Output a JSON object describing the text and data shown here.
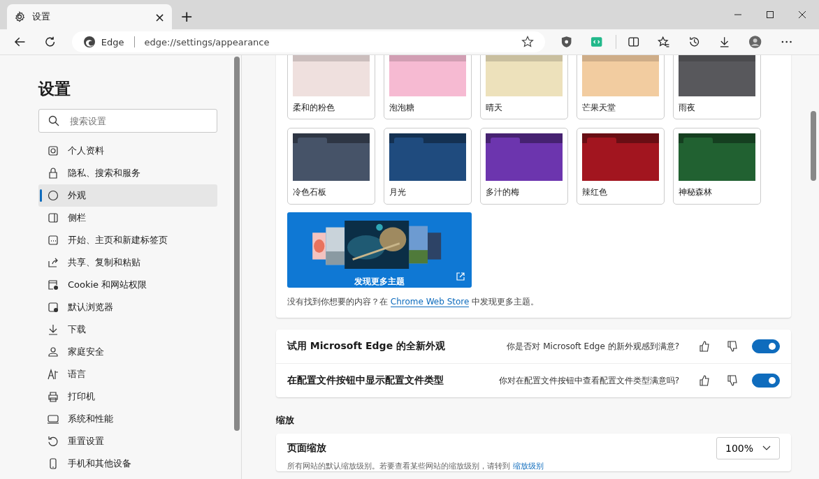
{
  "tab": {
    "title": "设置",
    "close": "×",
    "new_tab": "+"
  },
  "address": {
    "site": "Edge",
    "url": "edge://settings/appearance"
  },
  "sidebar": {
    "title": "设置",
    "search": {
      "placeholder": "搜索设置"
    },
    "items": [
      {
        "label": "个人资料",
        "selected": false
      },
      {
        "label": "隐私、搜索和服务",
        "selected": false
      },
      {
        "label": "外观",
        "selected": true
      },
      {
        "label": "侧栏",
        "selected": false
      },
      {
        "label": "开始、主页和新建标签页",
        "selected": false
      },
      {
        "label": "共享、复制和粘贴",
        "selected": false
      },
      {
        "label": "Cookie 和网站权限",
        "selected": false
      },
      {
        "label": "默认浏览器",
        "selected": false
      },
      {
        "label": "下载",
        "selected": false
      },
      {
        "label": "家庭安全",
        "selected": false
      },
      {
        "label": "语言",
        "selected": false
      },
      {
        "label": "打印机",
        "selected": false
      },
      {
        "label": "系统和性能",
        "selected": false
      },
      {
        "label": "重置设置",
        "selected": false
      },
      {
        "label": "手机和其他设备",
        "selected": false
      }
    ]
  },
  "themes": [
    {
      "name": "柔和的粉色",
      "color": "#efe0de"
    },
    {
      "name": "泡泡糖",
      "color": "#f6bad2"
    },
    {
      "name": "晴天",
      "color": "#ede1bb"
    },
    {
      "name": "芒果天堂",
      "color": "#f2cca0"
    },
    {
      "name": "雨夜",
      "color": "#58585c"
    },
    {
      "name": "冷色石板",
      "color": "#465368"
    },
    {
      "name": "月光",
      "color": "#1f4b7e"
    },
    {
      "name": "多汁的梅",
      "color": "#6c35ae"
    },
    {
      "name": "辣红色",
      "color": "#a2151f"
    },
    {
      "name": "神秘森林",
      "color": "#216131"
    }
  ],
  "discover": {
    "label": "发现更多主题"
  },
  "note": {
    "before": "没有找到你想要的内容？在",
    "link": "Chrome Web Store",
    "after": "中发现更多主题。"
  },
  "feedback_rows": [
    {
      "title": "试用 Microsoft Edge 的全新外观",
      "question": "你是否对 Microsoft Edge 的新外观感到满意?",
      "on": true
    },
    {
      "title": "在配置文件按钮中显示配置文件类型",
      "question": "你对在配置文件按钮中查看配置文件类型满意吗?",
      "on": true
    }
  ],
  "zoom": {
    "heading": "缩放",
    "label": "页面缩放",
    "value": "100%",
    "description": "所有网站的默认缩放级别。若要查看某些网站的缩放级别，请转到",
    "link": "缩放级别"
  }
}
